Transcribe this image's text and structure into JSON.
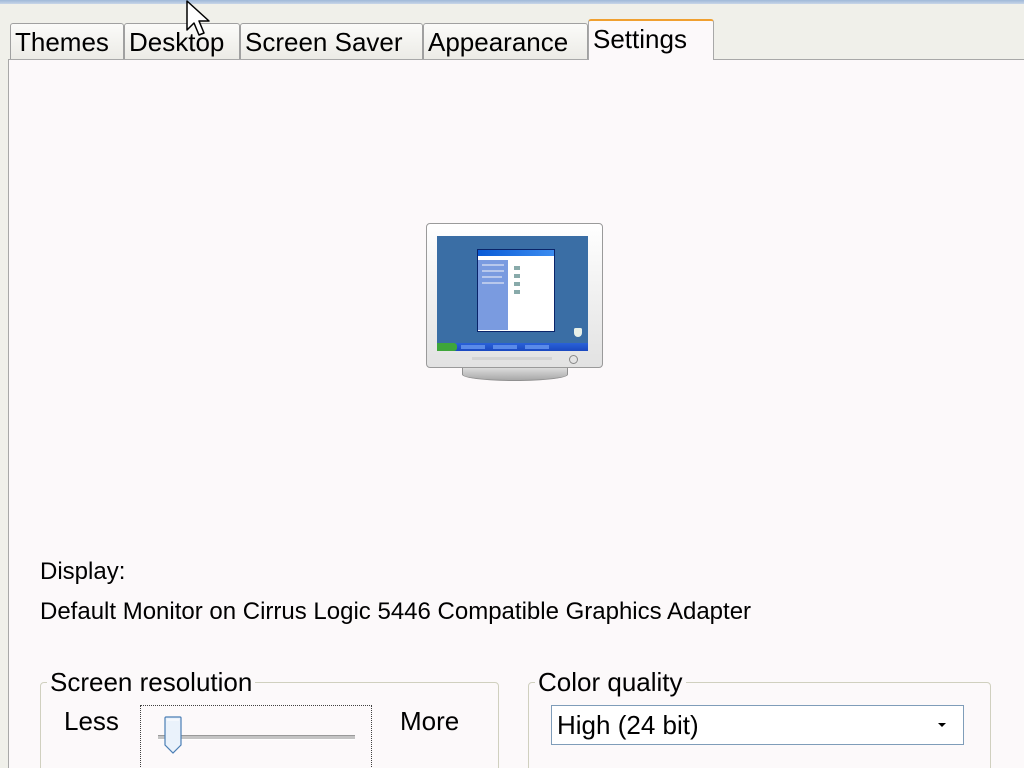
{
  "tabs": [
    {
      "label": "Themes",
      "active": false
    },
    {
      "label": "Desktop",
      "active": false
    },
    {
      "label": "Screen Saver",
      "active": false
    },
    {
      "label": "Appearance",
      "active": false
    },
    {
      "label": "Settings",
      "active": true
    }
  ],
  "monitor_preview": {
    "icon": "monitor-icon"
  },
  "display": {
    "label": "Display:",
    "value": "Default Monitor on Cirrus Logic 5446 Compatible Graphics Adapter"
  },
  "screen_resolution": {
    "title": "Screen resolution",
    "less_label": "Less",
    "more_label": "More",
    "slider_level": 0
  },
  "color_quality": {
    "title": "Color quality",
    "selected": "High (24 bit)"
  },
  "colors": {
    "active_tab_accent": "#f0a030",
    "panel_background": "#fcf9fa",
    "desktop_blue": "#3a6ea5"
  }
}
